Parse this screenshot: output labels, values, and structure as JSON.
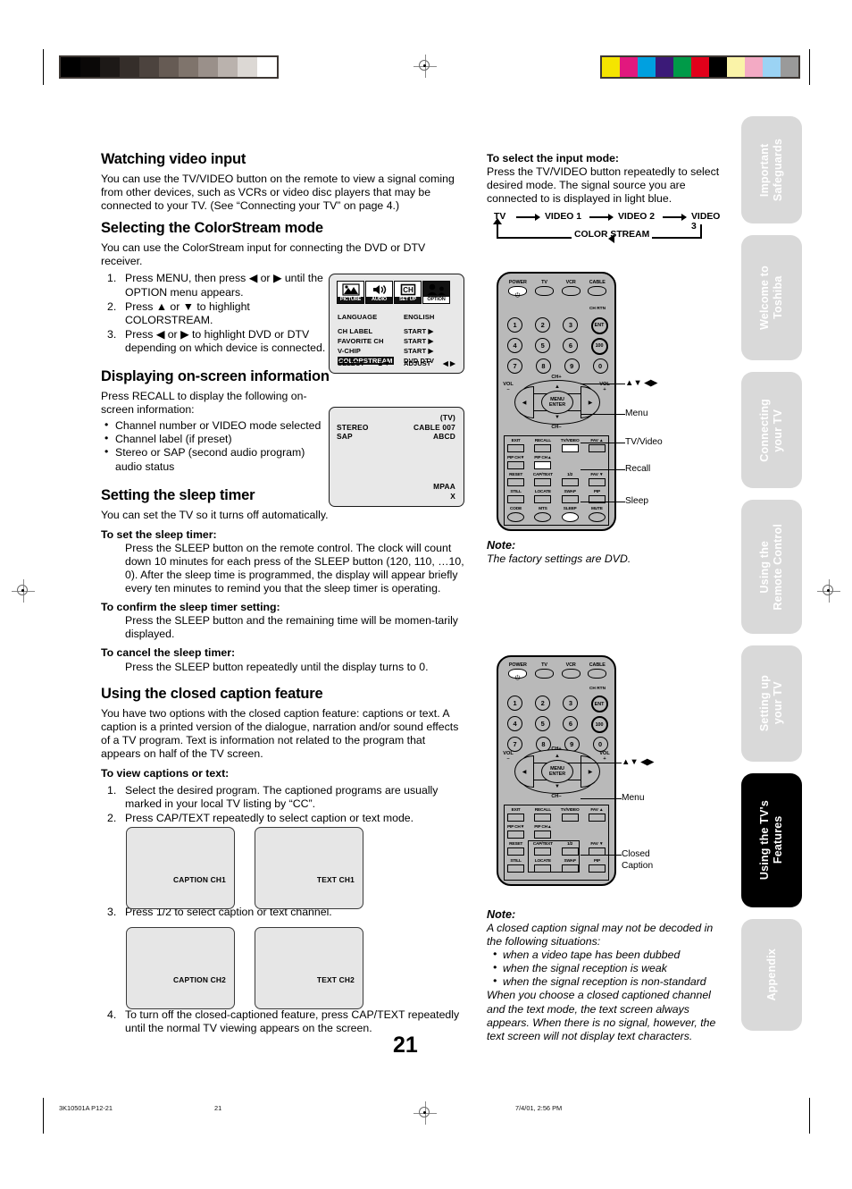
{
  "page": {
    "number": "21",
    "footer": {
      "left": "3K10501A P12-21",
      "center": "21",
      "right": "7/4/01, 2:56 PM"
    }
  },
  "sidebar": {
    "tabs": [
      {
        "label": "Important\nSafeguards",
        "active": false
      },
      {
        "label": "Welcome to\nToshiba",
        "active": false
      },
      {
        "label": "Connecting\nyour TV",
        "active": false
      },
      {
        "label": "Using the\nRemote Control",
        "active": false
      },
      {
        "label": "Setting up\nyour TV",
        "active": false
      },
      {
        "label": "Using the TV's\nFeatures",
        "active": true
      },
      {
        "label": "Appendix",
        "active": false
      }
    ],
    "inactive_color": "#d9d9d9",
    "active_color": "#000000",
    "text_color": "#ffffff"
  },
  "colorbars": {
    "left_grayscale": [
      "#000000",
      "#0a0807",
      "#1d1917",
      "#352e2a",
      "#4c433e",
      "#665b54",
      "#7f746c",
      "#9a908a",
      "#bab2ad",
      "#dcd8d4",
      "#ffffff"
    ],
    "right_colors": [
      "#f5e400",
      "#e2187e",
      "#00a0e0",
      "#3b1a78",
      "#009a48",
      "#e1001a",
      "#000000",
      "#faf3a8",
      "#f3aac4",
      "#9bd3f4",
      "#9a9a9a"
    ],
    "bar_bg": "#3d3733"
  },
  "left_column": {
    "s1": {
      "heading": "Watching video input",
      "body": "You can use the TV/VIDEO button on the remote to view a signal coming from other devices, such as VCRs or video disc players that may be connected to your TV. (See “Connecting your TV” on page 4.)"
    },
    "s2": {
      "heading": "Selecting the ColorStream mode",
      "body": "You can use the ColorStream input for connecting the DVD or DTV receiver.",
      "steps": [
        {
          "num": "1.",
          "text": "Press MENU, then press ◀ or ▶ until the OPTION menu appears."
        },
        {
          "num": "2.",
          "text": "Press ▲ or ▼ to highlight COLORSTREAM."
        },
        {
          "num": "3.",
          "text": "Press ◀ or ▶ to highlight DVD or DTV depending on which device is connected."
        }
      ]
    },
    "s3": {
      "heading": "Displaying on-screen information",
      "body": "Press RECALL to display the following on-screen information:",
      "bullets": [
        "Channel number or VIDEO mode selected",
        "Channel label (if preset)",
        "Stereo or SAP (second audio program) audio status"
      ]
    },
    "s4": {
      "heading": "Setting the sleep timer",
      "body": "You can set the TV so it turns off automatically.",
      "subs": [
        {
          "title": "To set the sleep timer:",
          "text": "Press the SLEEP button on the remote control. The clock will count down 10 minutes for each press of the SLEEP button (120, 110, …10, 0). After the sleep time is programmed, the display will appear briefly every ten minutes to remind you that the sleep timer is operating."
        },
        {
          "title": "To confirm the sleep timer setting:",
          "text": "Press the SLEEP button and the remaining time will be momen-tarily displayed."
        },
        {
          "title": "To cancel the sleep timer:",
          "text": "Press the SLEEP button repeatedly until the display turns to 0."
        }
      ]
    },
    "s5": {
      "heading": "Using the closed caption feature",
      "body": "You have two options with the closed caption feature: captions or text. A caption is a printed version of the dialogue, narration and/or sound effects of a TV program. Text is information not related to the program that appears on half of the TV screen.",
      "sub_title": "To view captions or text:",
      "steps": [
        {
          "num": "1.",
          "text": "Select the desired program. The captioned programs are usually marked in your local TV listing by “CC”."
        },
        {
          "num": "2.",
          "text": "Press CAP/TEXT repeatedly to select caption or text mode."
        }
      ],
      "step3": {
        "num": "3.",
        "text": "Press 1/2 to select caption or text channel."
      },
      "step4": {
        "num": "4.",
        "text": "To turn off the closed-captioned feature, press CAP/TEXT repeatedly until the normal TV viewing appears on the screen."
      },
      "screens": [
        {
          "label": "CAPTION CH1"
        },
        {
          "label": "TEXT CH1"
        },
        {
          "label": "CAPTION CH2"
        },
        {
          "label": "TEXT CH2"
        }
      ]
    }
  },
  "option_menu_osd": {
    "icons": [
      {
        "caption": "PICTURE",
        "glyph": "picture-icon",
        "selected": false
      },
      {
        "caption": "AUDIO",
        "glyph": "speaker-icon",
        "selected": false
      },
      {
        "caption": "SET UP",
        "glyph": "ch-icon",
        "selected": false
      },
      {
        "caption": "OPTION",
        "glyph": "people-icon",
        "selected": true
      }
    ],
    "rows": [
      {
        "label": "LANGUAGE",
        "value": "ENGLISH",
        "highlight": false
      },
      {
        "label": "CH LABEL",
        "value": "START ▶",
        "highlight": false
      },
      {
        "label": "FAVORITE CH",
        "value": "START ▶",
        "highlight": false
      },
      {
        "label": "V-CHIP",
        "value": "START ▶",
        "highlight": false
      },
      {
        "label": "COLORSTREAM",
        "value": "DVD  DTV",
        "highlight": true
      }
    ],
    "footer": {
      "select": "SELECT",
      "select_arrows": "▲▼",
      "adjust": "ADJUST",
      "adjust_arrows": "◀ ▶"
    }
  },
  "recall_osd": {
    "tv": "(TV)",
    "stereo": "STEREO",
    "sap": "SAP",
    "cable": "CABLE  007",
    "abcd": "ABCD",
    "mpaa": "MPAA",
    "rating": "X"
  },
  "right_column": {
    "input_mode": {
      "title": "To select the input mode:",
      "body": "Press the TV/VIDEO button repeatedly to select desired mode. The signal source you are connected to is displayed in light blue.",
      "flow": {
        "nodes": [
          "TV",
          "VIDEO 1",
          "VIDEO 2",
          "VIDEO 3"
        ],
        "return_label": "COLOR\nSTREAM"
      }
    },
    "note1": {
      "title": "Note:",
      "body": "The factory settings are DVD."
    },
    "note2": {
      "title": "Note:",
      "intro": "A closed caption signal may not be decoded in the following situations:",
      "bullets": [
        "when a video tape has been dubbed",
        "when the signal reception is weak",
        "when the signal reception is non-standard"
      ],
      "outro": "When you choose a closed captioned channel and the text mode, the text screen always appears. When there is no signal, however, the text screen will not display text characters."
    }
  },
  "remote": {
    "top_buttons": [
      {
        "label": "POWER",
        "shape": "power"
      },
      {
        "label": "TV",
        "shape": "oval"
      },
      {
        "label": "VCR",
        "shape": "oval"
      },
      {
        "label": "CABLE",
        "shape": "oval"
      }
    ],
    "ch_rtn": "CH RTN",
    "numpad": [
      [
        "1",
        "2",
        "3",
        "ENT"
      ],
      [
        "4",
        "5",
        "6",
        "100"
      ],
      [
        "7",
        "8",
        "9",
        "0"
      ]
    ],
    "ch_plus": "CH+",
    "ch_minus": "CH–",
    "vol_minus_top": "VOL",
    "vol_minus_bot": "–",
    "vol_plus_top": "VOL",
    "vol_plus_bot": "+",
    "menu_line1": "MENU",
    "menu_line2": "ENTER",
    "lower_rows": [
      [
        "EXIT",
        "RECALL",
        "TV/VIDEO",
        "FAV ▲"
      ],
      [
        "PIP CH▼",
        "PIP CH▲",
        "",
        ""
      ],
      [
        "RESET",
        "CAP/TEXT",
        "1/2",
        "FAV ▼"
      ],
      [
        "STILL",
        "LOCATE",
        "SWAP",
        "PIP"
      ],
      [
        "CODE",
        "MTS",
        "SLEEP",
        "MUTE"
      ]
    ],
    "callouts_1": [
      "▲▼ ◀▶",
      "Menu",
      "TV/Video",
      "Recall",
      "Sleep"
    ],
    "callouts_2": [
      "▲▼ ◀▶",
      "Menu",
      "Closed\nCaption"
    ]
  }
}
